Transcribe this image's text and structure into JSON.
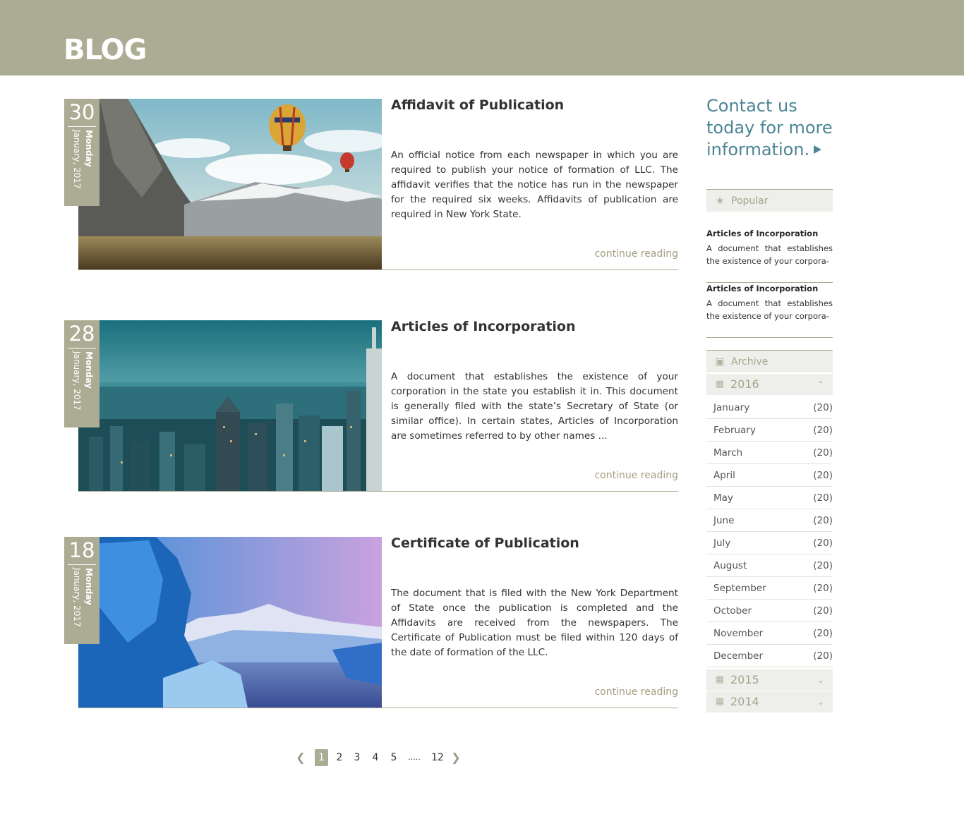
{
  "header": {
    "title": "BLOG"
  },
  "posts": [
    {
      "day": "30",
      "weekday": "Monday",
      "month_year": "January, 2017",
      "title": "Affidavit of Publication",
      "excerpt": "An official notice from each newspaper in which you are required to publish your notice of formation of LLC. The affidavit verifies that the notice has run in the newspaper for the required six weeks. Affidavits of publication are required in New York State.",
      "more": "continue reading",
      "image": "mountain-hot-air-balloons"
    },
    {
      "day": "28",
      "weekday": "Monday",
      "month_year": "January, 2017",
      "title": "Articles of Incorporation",
      "excerpt": "A document that establishes the existence of your corporation in the state you establish it in. This document is generally filed with the state’s Secretary of State (or similar office). In certain states, Articles of Incorporation are sometimes referred to by other names ...",
      "more": "continue reading",
      "image": "city-skyline"
    },
    {
      "day": "18",
      "weekday": "Monday",
      "month_year": "January, 2017",
      "title": "Certificate of Publication",
      "excerpt": "The document that is filed with the New York Department of State once the publication is completed and the Affidavits are received from the newspapers.  The Certificate of Publication must be filed within 120 days of the date of formation of the LLC.",
      "more": "continue reading",
      "image": "glacier-ice"
    }
  ],
  "pagination": {
    "prev_icon": "chevron-left-icon",
    "pages": [
      "1",
      "2",
      "3",
      "4",
      "5",
      ".....",
      "12"
    ],
    "current": "1",
    "next_icon": "chevron-right-icon"
  },
  "sidebar": {
    "cta": "Contact us today for more information.",
    "popular": {
      "label": "Popular",
      "icon": "star-icon",
      "items": [
        {
          "title": "Articles of Incorporation",
          "excerpt": "A document that establishes the existence of your corpora-"
        },
        {
          "title": "Articles of Incorporation",
          "excerpt": "A document that establishes the existence of your corpora-"
        }
      ]
    },
    "archive": {
      "label": "Archive",
      "icon": "archive-box-icon",
      "years": [
        {
          "year": "2016",
          "expanded": true,
          "months": [
            {
              "name": "January",
              "count": "(20)"
            },
            {
              "name": "February",
              "count": "(20)"
            },
            {
              "name": "March",
              "count": "(20)"
            },
            {
              "name": "April",
              "count": "(20)"
            },
            {
              "name": "May",
              "count": "(20)"
            },
            {
              "name": "June",
              "count": "(20)"
            },
            {
              "name": "July",
              "count": "(20)"
            },
            {
              "name": "August",
              "count": "(20)"
            },
            {
              "name": "September",
              "count": "(20)"
            },
            {
              "name": "October",
              "count": "(20)"
            },
            {
              "name": "November",
              "count": "(20)"
            },
            {
              "name": "December",
              "count": "(20)"
            }
          ]
        },
        {
          "year": "2015",
          "expanded": false
        },
        {
          "year": "2014",
          "expanded": false
        }
      ]
    }
  },
  "colors": {
    "brand": "#abac93",
    "accent_link": "#4b8596",
    "panel_bg": "#eeeeea"
  }
}
